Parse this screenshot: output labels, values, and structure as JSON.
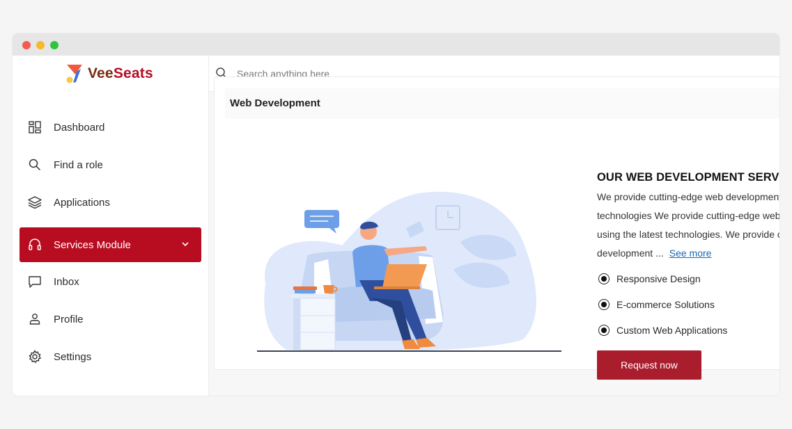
{
  "brand": {
    "name_part1": "Vee",
    "name_part2": "Seats",
    "color_primary": "#b80c21"
  },
  "search": {
    "placeholder": "Search anything here"
  },
  "sidebar": {
    "items": [
      {
        "label": "Dashboard",
        "icon": "dashboard-icon"
      },
      {
        "label": "Find a role",
        "icon": "search-icon"
      },
      {
        "label": "Applications",
        "icon": "layers-icon"
      },
      {
        "label": "Services Module",
        "icon": "headset-icon",
        "active": true
      },
      {
        "label": "Inbox",
        "icon": "chat-icon"
      },
      {
        "label": "Profile",
        "icon": "user-icon"
      },
      {
        "label": "Settings",
        "icon": "gear-icon"
      }
    ]
  },
  "card": {
    "title": "Web Development",
    "service_title": "OUR WEB DEVELOPMENT SERVICES",
    "description": "We provide cutting-edge web development services using the latest technologies We provide cutting-edge web development services using the latest technologies. We provide cutting-edge web development ...",
    "see_more": "See more",
    "features": [
      "Responsive Design",
      "E-commerce Solutions",
      "Custom Web Applications"
    ],
    "request_button": "Request now"
  }
}
